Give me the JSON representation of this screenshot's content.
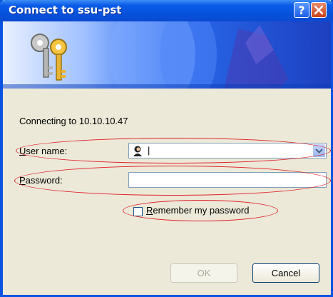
{
  "window": {
    "title": "Connect to ssu-pst"
  },
  "titlebar_buttons": {
    "help": "?",
    "close": "X"
  },
  "connecting_text": "Connecting to 10.10.10.47",
  "username": {
    "label_first": "U",
    "label_rest": "ser name:",
    "value": "|"
  },
  "password": {
    "label_first": "P",
    "label_rest": "assword:",
    "value": ""
  },
  "remember": {
    "label_first": "R",
    "label_rest": "emember my password",
    "checked": false
  },
  "buttons": {
    "ok": "OK",
    "cancel": "Cancel"
  },
  "colors": {
    "titlebar": "#0a54e3",
    "annotation": "#e0202a",
    "face": "#ece9d8"
  }
}
